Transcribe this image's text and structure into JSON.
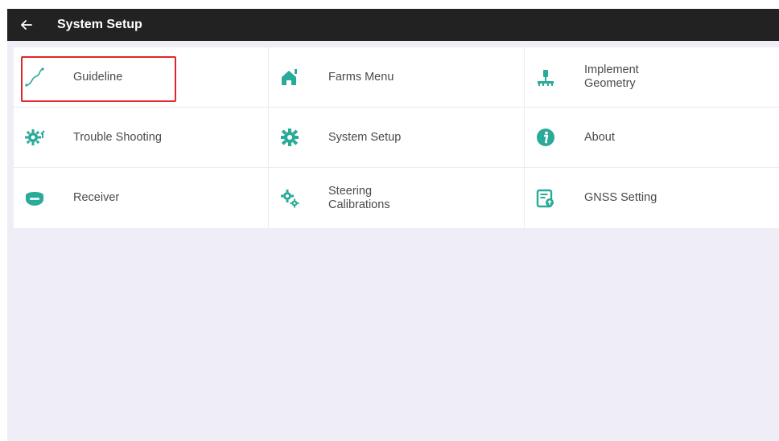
{
  "header": {
    "back_icon": "arrow-left-icon",
    "title": "System Setup"
  },
  "accent_color": "#2aaa98",
  "highlight_color": "#e0262b",
  "menu": {
    "items": [
      {
        "label": "Guideline",
        "icon": "guideline-curve-icon",
        "selected": true
      },
      {
        "label": "Farms Menu",
        "icon": "farm-house-icon",
        "selected": false
      },
      {
        "label": "Implement\nGeometry",
        "icon": "implement-icon",
        "selected": false
      },
      {
        "label": "Trouble Shooting",
        "icon": "gear-wrench-icon",
        "selected": false
      },
      {
        "label": "System Setup",
        "icon": "gear-icon",
        "selected": false
      },
      {
        "label": "About",
        "icon": "info-icon",
        "selected": false
      },
      {
        "label": "Receiver",
        "icon": "receiver-icon",
        "selected": false
      },
      {
        "label": "Steering\nCalibrations",
        "icon": "gears-icon",
        "selected": false
      },
      {
        "label": "GNSS Setting",
        "icon": "gnss-setting-icon",
        "selected": false
      }
    ]
  }
}
